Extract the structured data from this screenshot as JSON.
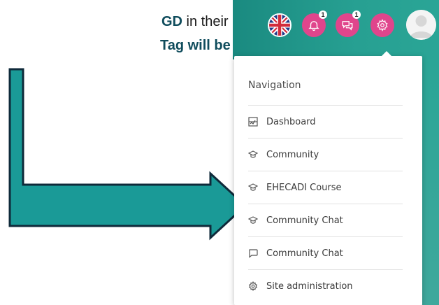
{
  "document": {
    "line1_highlight": "GD",
    "line1_text": " in their",
    "line2_text": "Tag will be"
  },
  "topbar": {
    "icons": {
      "language": "uk-flag-icon",
      "notifications": "notification-bell-icon",
      "messages": "chat-bubbles-icon",
      "settings": "gear-icon",
      "user": "user-avatar-icon"
    },
    "notifications_count": "1",
    "messages_count": "1"
  },
  "navigation": {
    "heading": "Navigation",
    "items": [
      {
        "label": "Dashboard",
        "icon": "dashboard-icon"
      },
      {
        "label": "Community",
        "icon": "graduation-cap-icon"
      },
      {
        "label": "EHECADI Course",
        "icon": "graduation-cap-icon"
      },
      {
        "label": "Community Chat",
        "icon": "graduation-cap-icon"
      },
      {
        "label": "Community Chat",
        "icon": "speech-bubble-icon"
      },
      {
        "label": "Site administration",
        "icon": "gear-icon"
      }
    ]
  },
  "colors": {
    "teal": "#1a8a80",
    "pink": "#e0458c",
    "arrow_fill": "#1a9a97",
    "arrow_stroke": "#0f2a3a"
  }
}
